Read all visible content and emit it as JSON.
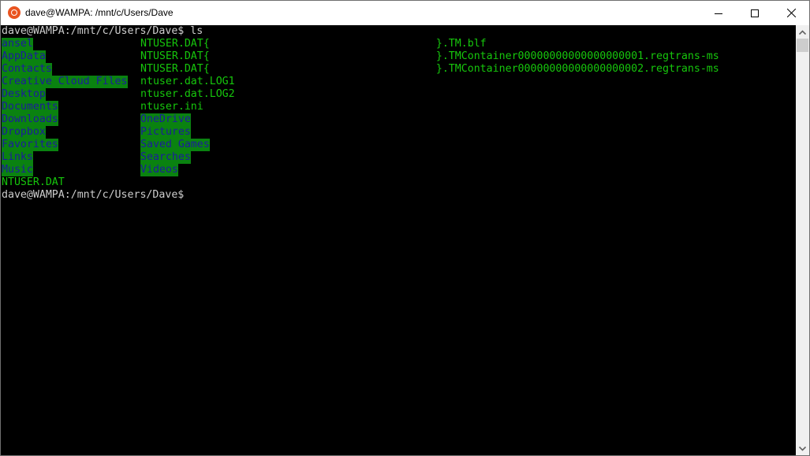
{
  "window": {
    "title": "dave@WAMPA: /mnt/c/Users/Dave",
    "app_icon": "ubuntu-icon",
    "controls": [
      "minimize",
      "maximize",
      "close"
    ]
  },
  "colors": {
    "directory_bg": "#0a8210",
    "directory_fg": "#1c1c9c",
    "file_fg": "#16c60c",
    "prompt_fg": "#cccccc",
    "background": "#000000"
  },
  "terminal": {
    "command_prompt": "dave@WAMPA:/mnt/c/Users/Dave$ ls",
    "listing_col1": [
      {
        "name": "ansel",
        "type": "dir"
      },
      {
        "name": "AppData",
        "type": "dir"
      },
      {
        "name": "Contacts",
        "type": "dir"
      },
      {
        "name": "Creative Cloud Files",
        "type": "dir"
      },
      {
        "name": "Desktop",
        "type": "dir"
      },
      {
        "name": "Documents",
        "type": "dir"
      },
      {
        "name": "Downloads",
        "type": "dir"
      },
      {
        "name": "Dropbox",
        "type": "dir"
      },
      {
        "name": "Favorites",
        "type": "dir"
      },
      {
        "name": "Links",
        "type": "dir"
      },
      {
        "name": "Music",
        "type": "dir"
      },
      {
        "name": "NTUSER.DAT",
        "type": "file"
      }
    ],
    "listing_col2": [
      {
        "prefix": "NTUSER.DAT{",
        "suffix": "}.TM.blf",
        "type": "file"
      },
      {
        "prefix": "NTUSER.DAT{",
        "suffix": "}.TMContainer00000000000000000001.regtrans-ms",
        "type": "file"
      },
      {
        "prefix": "NTUSER.DAT{",
        "suffix": "}.TMContainer00000000000000000002.regtrans-ms",
        "type": "file"
      },
      {
        "prefix": "ntuser.dat.LOG1",
        "suffix": "",
        "type": "file"
      },
      {
        "prefix": "ntuser.dat.LOG2",
        "suffix": "",
        "type": "file"
      },
      {
        "prefix": "ntuser.ini",
        "suffix": "",
        "type": "file"
      },
      {
        "prefix": "OneDrive",
        "suffix": "",
        "type": "dir"
      },
      {
        "prefix": "Pictures",
        "suffix": "",
        "type": "dir"
      },
      {
        "prefix": "Saved Games",
        "suffix": "",
        "type": "dir"
      },
      {
        "prefix": "Searches",
        "suffix": "",
        "type": "dir"
      },
      {
        "prefix": "Videos",
        "suffix": "",
        "type": "dir"
      }
    ],
    "redacted_placeholder": "████████-████-████-████-████████████",
    "final_prompt": "dave@WAMPA:/mnt/c/Users/Dave$"
  }
}
